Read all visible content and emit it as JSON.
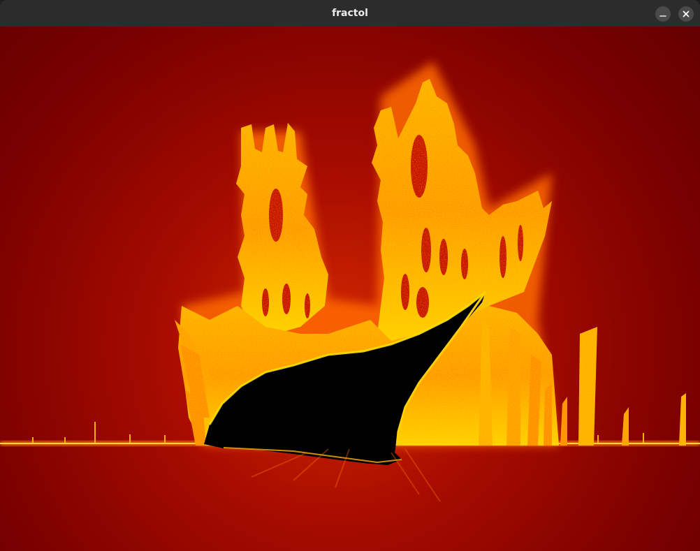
{
  "window": {
    "title": "fractol"
  },
  "titlebar_buttons": [
    {
      "name": "minimize",
      "icon": "minimize-icon"
    },
    {
      "name": "close",
      "icon": "close-icon"
    }
  ],
  "colors": {
    "background_dark": "#6e0000",
    "background_mid": "#a80c00",
    "fractal_orange": "#ff8a00",
    "fractal_yellow": "#ffe000",
    "set_interior": "#000000",
    "titlebar": "#2c2c2c"
  }
}
